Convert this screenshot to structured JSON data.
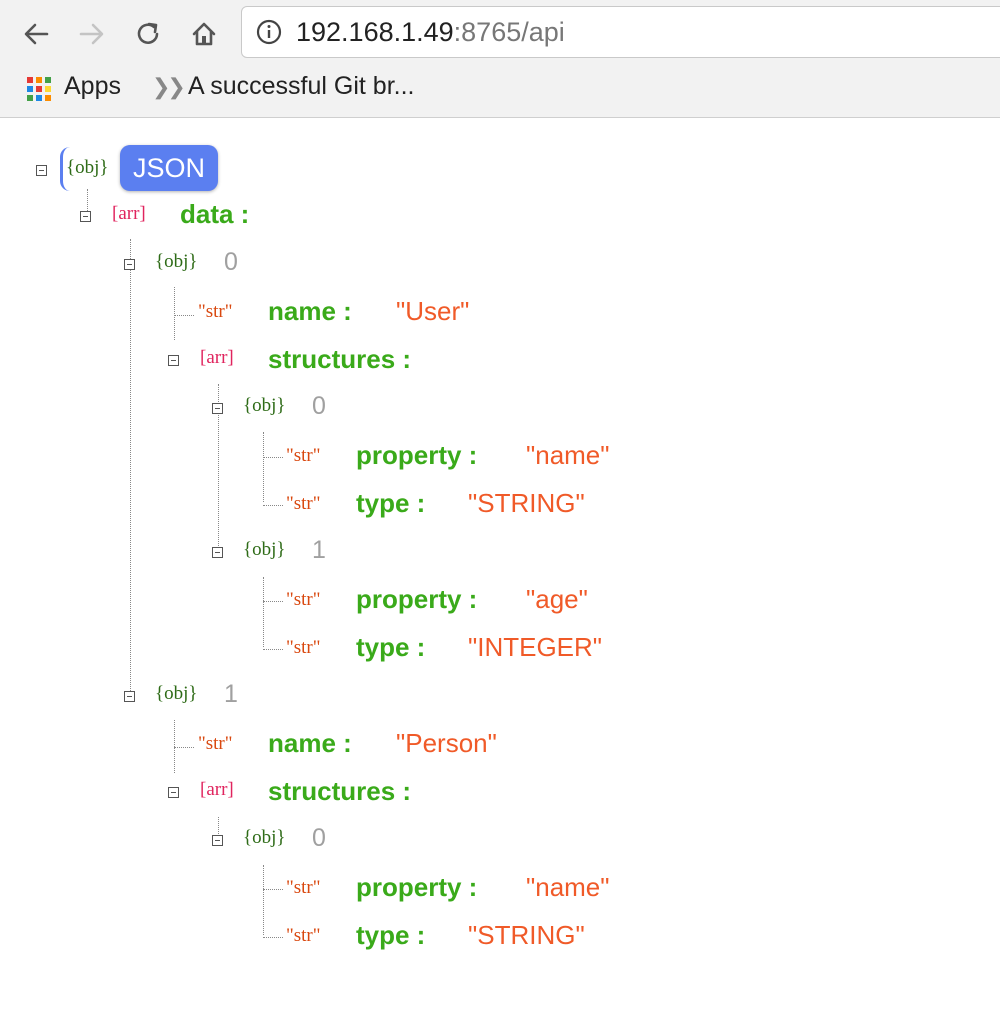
{
  "browser": {
    "url_host": "192.168.1.49",
    "url_rest": ":8765/api",
    "bookmarks": {
      "apps_label": "Apps",
      "link_label": "A successful Git br..."
    }
  },
  "viewer": {
    "badge": "JSON",
    "tags": {
      "obj": "{obj}",
      "arr": "[arr]",
      "str": "\"str\""
    },
    "root": {
      "key": "data :"
    },
    "items": [
      {
        "index": "0",
        "name_key": "name :",
        "name_value": "\"User\"",
        "structures_key": "structures :",
        "structures": [
          {
            "index": "0",
            "property_key": "property :",
            "property_value": "\"name\"",
            "type_key": "type :",
            "type_value": "\"STRING\""
          },
          {
            "index": "1",
            "property_key": "property :",
            "property_value": "\"age\"",
            "type_key": "type :",
            "type_value": "\"INTEGER\""
          }
        ]
      },
      {
        "index": "1",
        "name_key": "name :",
        "name_value": "\"Person\"",
        "structures_key": "structures :",
        "structures": [
          {
            "index": "0",
            "property_key": "property :",
            "property_value": "\"name\"",
            "type_key": "type :",
            "type_value": "\"STRING\""
          }
        ]
      }
    ]
  }
}
